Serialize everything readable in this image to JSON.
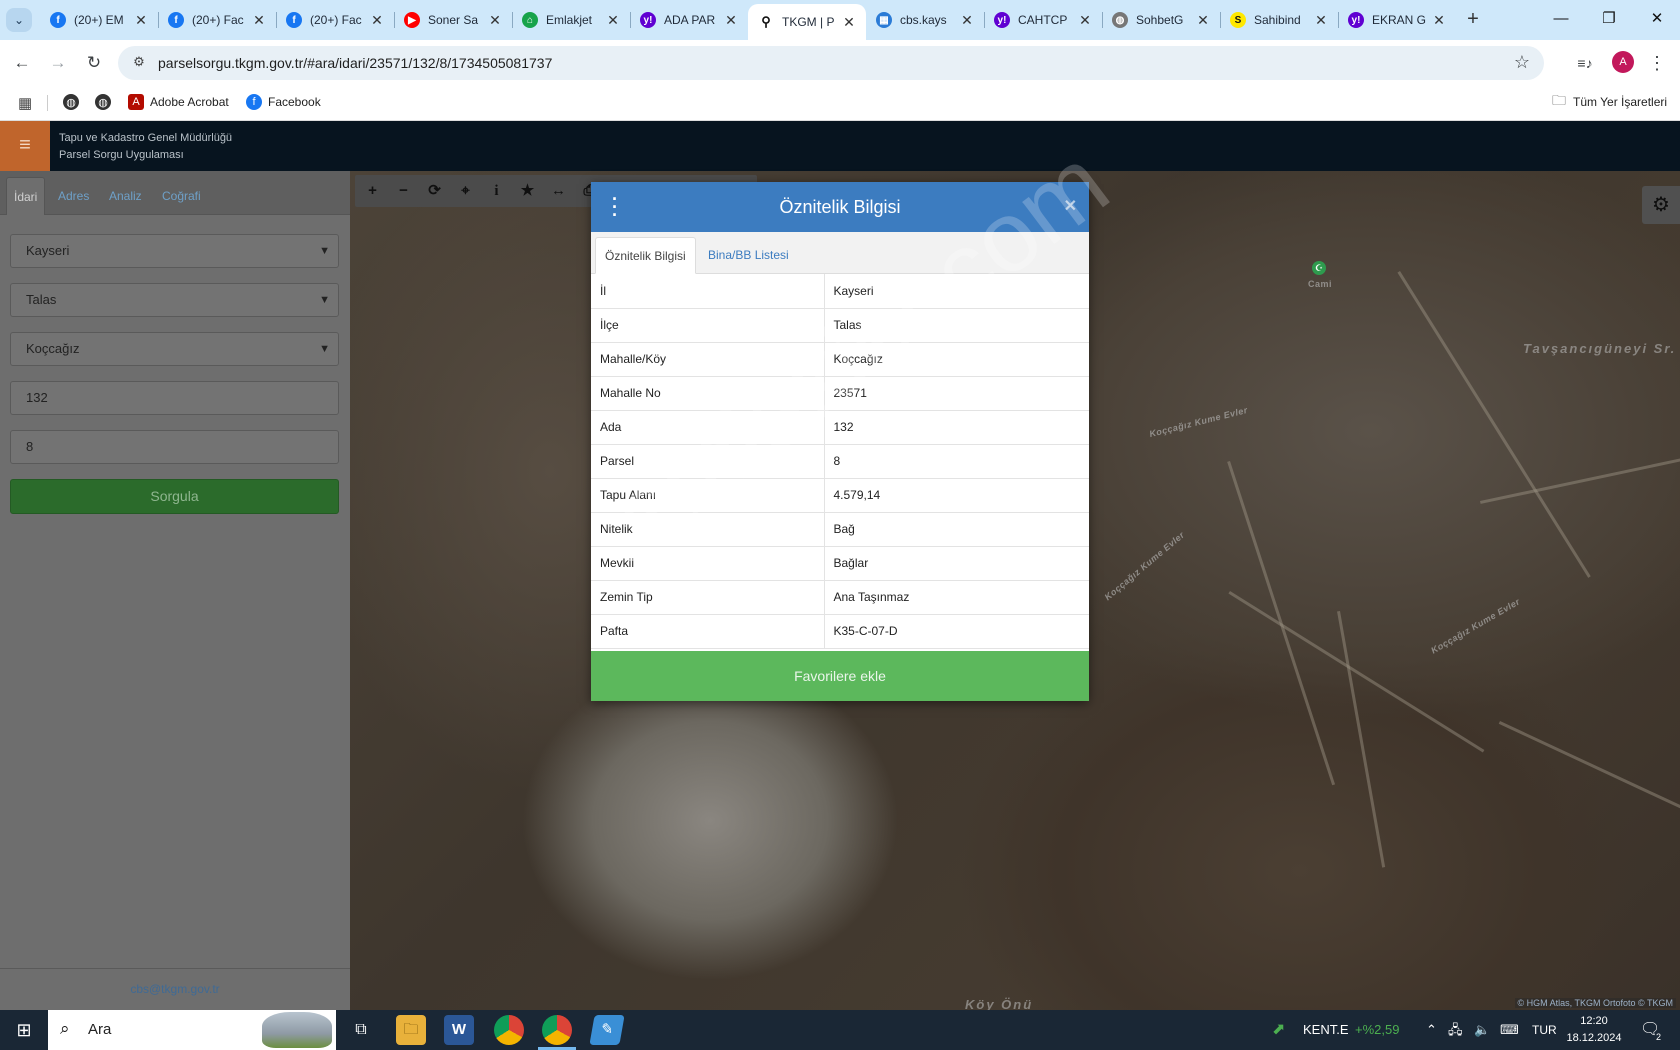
{
  "browser": {
    "tabs": [
      {
        "title": "(20+) EM",
        "icon": "facebook-icon",
        "color": "#1877f2",
        "glyph": "f"
      },
      {
        "title": "(20+) Fac",
        "icon": "facebook-icon",
        "color": "#1877f2",
        "glyph": "f"
      },
      {
        "title": "(20+) Fac",
        "icon": "facebook-icon",
        "color": "#1877f2",
        "glyph": "f"
      },
      {
        "title": "Soner Sa",
        "icon": "youtube-icon",
        "color": "#ff0000",
        "glyph": "▶"
      },
      {
        "title": "Emlakjet",
        "icon": "home-icon",
        "color": "#17a34a",
        "glyph": "⌂"
      },
      {
        "title": "ADA PAR",
        "icon": "yahoo-icon",
        "color": "#6001d2",
        "glyph": "y!"
      },
      {
        "title": "TKGM | P",
        "icon": "map-pin-icon",
        "color": "#111111",
        "glyph": "⚲"
      },
      {
        "title": "cbs.kays",
        "icon": "globe-grid-icon",
        "color": "#2b7bd6",
        "glyph": "▦"
      },
      {
        "title": "CAHTCP",
        "icon": "yahoo-icon",
        "color": "#6001d2",
        "glyph": "y!"
      },
      {
        "title": "SohbetG",
        "icon": "globe-icon",
        "color": "#777777",
        "glyph": "◍"
      },
      {
        "title": "Sahibind",
        "icon": "sahibinden-icon",
        "color": "#ffe800",
        "glyph": "S"
      },
      {
        "title": "EKRAN G",
        "icon": "yahoo-icon",
        "color": "#6001d2",
        "glyph": "y!"
      }
    ],
    "active_tab": 6,
    "url": "parselsorgu.tkgm.gov.tr/#ara/idari/23571/132/8/1734505081737",
    "avatar_letter": "A",
    "bookmarks": [
      {
        "label": "",
        "icon": "globe-icon"
      },
      {
        "label": "",
        "icon": "globe-icon"
      },
      {
        "label": "Adobe Acrobat",
        "icon": "acrobat-icon"
      },
      {
        "label": "Facebook",
        "icon": "facebook-icon"
      }
    ],
    "all_bookmarks_label": "Tüm Yer İşaretleri"
  },
  "app": {
    "title_line1": "Tapu ve Kadastro Genel Müdürlüğü",
    "title_line2": "Parsel Sorgu Uygulaması",
    "accent": "#c0652c"
  },
  "sidebar": {
    "tabs": [
      "İdari",
      "Adres",
      "Analiz",
      "Coğrafi"
    ],
    "active_tab": 0,
    "il": "Kayseri",
    "ilce": "Talas",
    "mahalle": "Koçcağız",
    "ada": "132",
    "parsel": "8",
    "query_button": "Sorgula",
    "footer_email": "cbs@tkgm.gov.tr"
  },
  "map": {
    "tools": [
      "zoom-in-icon",
      "zoom-out-icon",
      "refresh-icon",
      "locate-icon",
      "info-icon",
      "star-icon",
      "measure-icon",
      "print-icon"
    ],
    "labels": {
      "cami": "Cami",
      "district": "Tavşancıgüneyi Sr.",
      "koy_onu": "Köy Önü",
      "road1": "Koççağız Kume Evler",
      "road2": "Koççağız Kume Evler",
      "road3": "Koççağız Kume Evler"
    },
    "attribution": "© HGM Atlas, TKGM Ortofoto © TKGM",
    "watermark": "emlakjet.com"
  },
  "modal": {
    "title": "Öznitelik Bilgisi",
    "tabs": [
      "Öznitelik Bilgisi",
      "Bina/BB Listesi"
    ],
    "active_tab": 0,
    "rows": [
      {
        "key": "İl",
        "value": "Kayseri"
      },
      {
        "key": "İlçe",
        "value": "Talas"
      },
      {
        "key": "Mahalle/Köy",
        "value": "Koçcağız"
      },
      {
        "key": "Mahalle No",
        "value": "23571"
      },
      {
        "key": "Ada",
        "value": "132"
      },
      {
        "key": "Parsel",
        "value": "8"
      },
      {
        "key": "Tapu Alanı",
        "value": "4.579,14"
      },
      {
        "key": "Nitelik",
        "value": "Bağ"
      },
      {
        "key": "Mevkii",
        "value": "Bağlar"
      },
      {
        "key": "Zemin Tip",
        "value": "Ana Taşınmaz"
      },
      {
        "key": "Pafta",
        "value": "K35-C-07-D"
      }
    ],
    "favorite_button": "Favorilere ekle",
    "header_color": "#3c7cc0",
    "button_color": "#5cb85c"
  },
  "taskbar": {
    "search_placeholder": "Ara",
    "stock_name": "KENT.E",
    "stock_change": "+%2,59",
    "language": "TUR",
    "time": "12:20",
    "date": "18.12.2024",
    "notification_count": "2"
  }
}
